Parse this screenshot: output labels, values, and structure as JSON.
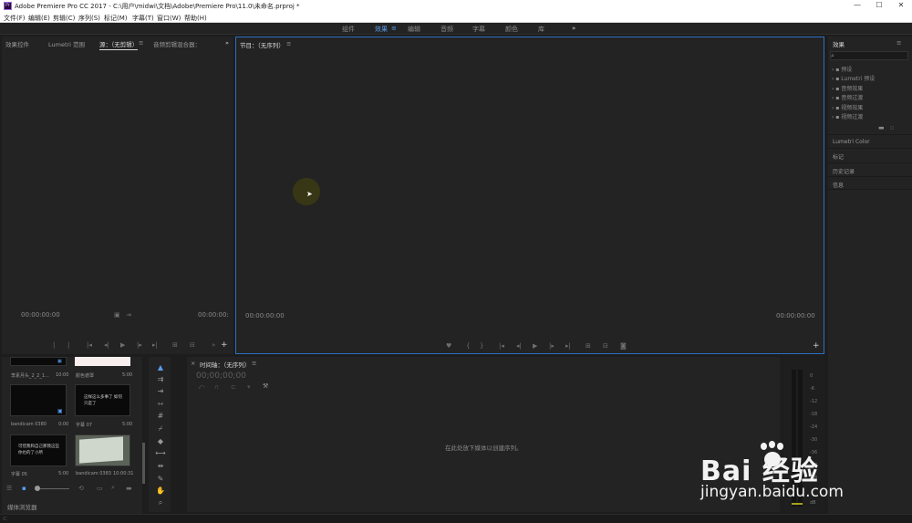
{
  "titlebar": {
    "title": "Adobe Premiere Pro CC 2017 - C:\\用户\\midwi\\文档\\Adobe\\Premiere Pro\\11.0\\未命名.prproj *",
    "logo_text": "Pr",
    "minimize": "—",
    "maximize": "☐",
    "close": "✕"
  },
  "menu": [
    "文件(F)",
    "编辑(E)",
    "剪辑(C)",
    "序列(S)",
    "标记(M)",
    "字幕(T)",
    "窗口(W)",
    "帮助(H)"
  ],
  "workspaces": [
    "组件",
    "效果",
    "编辑",
    "音频",
    "字幕",
    "颜色",
    "库"
  ],
  "workspace_active_index": 1,
  "workspace_more": "»",
  "source_panel": {
    "tabs": [
      "效果控件",
      "Lumetri 范围",
      "源：（无剪辑）",
      "音频剪辑混合器："
    ],
    "active_tab_index": 2,
    "more": "»",
    "timecode_left": "00:00:00:00",
    "timecode_right": "00:00:00:"
  },
  "program_panel": {
    "title": "节目：（无序列）",
    "timecode_left": "00:00:00:00",
    "timecode_right": "00:00:00:00"
  },
  "effects_panel": {
    "title": "效果",
    "search_placeholder": "",
    "items": [
      "预设",
      "Lumetri 预设",
      "音频效果",
      "音频过渡",
      "视频效果",
      "视频过渡"
    ],
    "sections": [
      "Lumetri Color",
      "标记",
      "历史记录",
      "信息"
    ]
  },
  "media_browser": {
    "label": "媒体浏览器",
    "clips": [
      {
        "name": "李素月头_2_2_1...",
        "duration": "10:00",
        "preview": ""
      },
      {
        "name": "颜色遮罩",
        "duration": "5:00",
        "preview": ""
      },
      {
        "name": "bandicam 0380",
        "duration": "0:00",
        "preview": ""
      },
      {
        "name": "字幕 07",
        "duration": "5:00",
        "preview": "这样这么多事了 如何只是了"
      },
      {
        "name": "字幕 05",
        "duration": "5:00",
        "preview": "可惜我和自己那我这些 你也的了小所"
      },
      {
        "name": "bandicam 0383",
        "duration": "10:00:31",
        "preview": ""
      }
    ]
  },
  "timeline_panel": {
    "title": "时间轴：（无序列）",
    "timecode": "00;00;00;00",
    "empty_message": "在此处放下媒体以创建序列。"
  },
  "audio_meter": {
    "scale": [
      "0",
      "-6",
      "-12",
      "-18",
      "-24",
      "-30",
      "-36",
      "-42",
      "-48",
      "dB"
    ]
  },
  "watermark": {
    "brand": "Bai 经验",
    "url": "jingyan.baidu.com"
  },
  "colors": {
    "accent": "#5a9bf0",
    "panel_bg": "#232323",
    "app_bg": "#1d1d1d",
    "program_border": "#2e6fc2"
  }
}
